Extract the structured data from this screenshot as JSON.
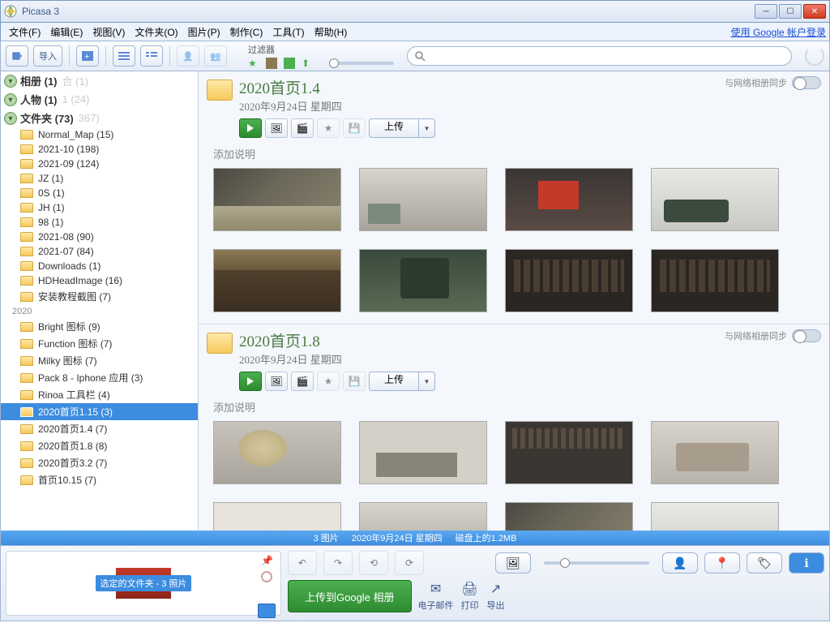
{
  "window": {
    "title": "Picasa 3"
  },
  "menu": {
    "file": "文件(F)",
    "edit": "编辑(E)",
    "view": "视图(V)",
    "folder": "文件夹(O)",
    "picture": "图片(P)",
    "make": "制作(C)",
    "tool": "工具(T)",
    "help": "帮助(H)",
    "login": "使用 Google 帐户登录"
  },
  "toolbar": {
    "import": "导入",
    "filter_label": "过滤器"
  },
  "sidebar": {
    "cats": [
      {
        "label": "相册 (1)",
        "ghost": "合 (1)"
      },
      {
        "label": "人物 (1)",
        "ghost": "1 (24)"
      },
      {
        "label": "文件夹 (73)",
        "ghost": "367)"
      }
    ],
    "year": "2020",
    "items": [
      {
        "label": "Normal_Map (15)"
      },
      {
        "label": "2021-10 (198)"
      },
      {
        "label": "2021-09 (124)"
      },
      {
        "label": "JZ (1)"
      },
      {
        "label": "0S (1)"
      },
      {
        "label": "JH (1)"
      },
      {
        "label": "98 (1)"
      },
      {
        "label": "2021-08 (90)"
      },
      {
        "label": "2021-07 (84)"
      },
      {
        "label": "Downloads (1)"
      },
      {
        "label": "HDHeadImage (16)"
      },
      {
        "label": "安装教程截图 (7)"
      }
    ],
    "items2": [
      {
        "label": "Bright 图标 (9)"
      },
      {
        "label": "Function 图标 (7)"
      },
      {
        "label": "Milky 图标 (7)"
      },
      {
        "label": "Pack 8 - Iphone 应用 (3)"
      },
      {
        "label": "Rinoa 工具栏 (4)"
      },
      {
        "label": "2020首页1.15 (3)",
        "selected": true
      },
      {
        "label": "2020首页1.4 (7)"
      },
      {
        "label": "2020首页1.8 (8)"
      },
      {
        "label": "2020首页3.2 (7)"
      },
      {
        "label": "首页10.15 (7)"
      }
    ]
  },
  "albums": [
    {
      "title": "2020首页1.4",
      "date": "2020年9月24日 星期四",
      "sync": "与网络相册同步",
      "upload": "上传",
      "desc": "添加说明",
      "thumbs": [
        "t1",
        "t2",
        "t3",
        "t4",
        "t5",
        "t6",
        "t7",
        "t7"
      ]
    },
    {
      "title": "2020首页1.8",
      "date": "2020年9月24日 星期四",
      "sync": "与网络相册同步",
      "upload": "上传",
      "desc": "添加说明",
      "thumbs": [
        "t9",
        "t10",
        "t11",
        "t12",
        "t8",
        "t2",
        "t1",
        "t4"
      ]
    }
  ],
  "status": {
    "count": "3 图片",
    "date": "2020年9月24日 星期四",
    "disk": "磁盘上的1.2MB"
  },
  "tray": {
    "label": "选定的文件夹 - 3 照片"
  },
  "bottom": {
    "upload": "上传到Google 相册",
    "email": "电子邮件",
    "print": "打印",
    "export": "导出"
  }
}
